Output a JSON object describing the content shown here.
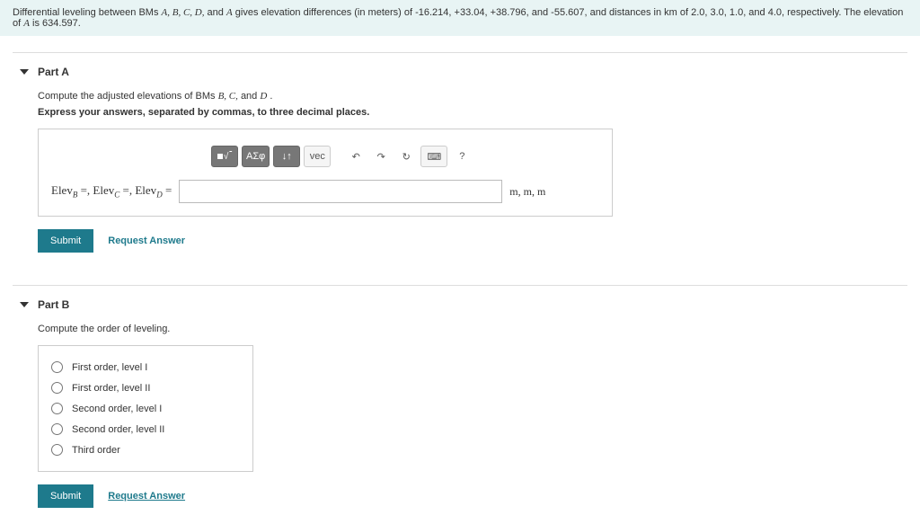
{
  "problem": {
    "prefix": "Differential leveling between BMs ",
    "bms": "A, B, C, D,",
    "mid1": " and ",
    "bm_last": "A",
    "mid2": " gives elevation differences (in meters) of -16.214, +33.04, +38.796, and -55.607, and distances in km of 2.0, 3.0, 1.0, and 4.0, respectively. The elevation of ",
    "bm_ref": "A",
    "suffix": " is 634.597."
  },
  "partA": {
    "title": "Part A",
    "instr1_prefix": "Compute the adjusted elevations of BMs ",
    "instr1_vars": "B, C,",
    "instr1_mid": " and ",
    "instr1_last": "D",
    "instr1_suffix": ".",
    "instr2": "Express your answers, separated by commas, to three decimal places.",
    "toolbar": {
      "greek": "ΑΣφ",
      "arrows": "↓↑",
      "vec": "vec",
      "undo": "↶",
      "redo": "↷",
      "reset": "↻",
      "keyboard": "⌨",
      "help": "?"
    },
    "label_parts": {
      "e1": "Elev",
      "s1": "B",
      "eq1": " =, ",
      "e2": "Elev",
      "s2": "C",
      "eq2": " =, ",
      "e3": "Elev",
      "s3": "D",
      "eq3": " ="
    },
    "unit": "m, m, m",
    "submit": "Submit",
    "request": "Request Answer"
  },
  "partB": {
    "title": "Part B",
    "instr": "Compute the order of leveling.",
    "options": [
      "First order, level I",
      "First order, level II",
      "Second order, level I",
      "Second order, level II",
      "Third order"
    ],
    "submit": "Submit",
    "request": "Request Answer"
  }
}
